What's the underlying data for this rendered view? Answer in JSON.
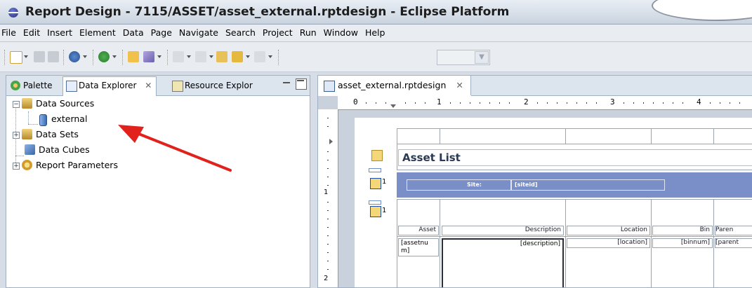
{
  "window": {
    "title": "Report Design - 7115/ASSET/asset_external.rptdesign - Eclipse Platform"
  },
  "menu": [
    "File",
    "Edit",
    "Insert",
    "Element",
    "Data",
    "Page",
    "Navigate",
    "Search",
    "Project",
    "Run",
    "Window",
    "Help"
  ],
  "left_panel": {
    "tabs": [
      {
        "label": "Palette"
      },
      {
        "label": "Data Explorer",
        "close": "✕"
      },
      {
        "label": "Resource Explor"
      }
    ],
    "tree": {
      "data_sources": "Data Sources",
      "external": "external",
      "data_sets": "Data Sets",
      "data_cubes": "Data Cubes",
      "report_parameters": "Report Parameters"
    }
  },
  "editor": {
    "tab_label": "asset_external.rptdesign",
    "tab_close": "✕",
    "ruler_numbers": [
      "0",
      "1",
      "2",
      "3",
      "4"
    ],
    "ruler_left_numbers": [
      "1",
      "2"
    ],
    "report": {
      "title": "Asset List",
      "group_site_label": "Site:",
      "group_site_value": "[siteid]",
      "row_markers": [
        "1",
        "1"
      ],
      "columns": [
        "Asset",
        "Description",
        "Location",
        "Bin",
        "Paren"
      ],
      "detail": [
        "[assetnum]",
        "[description]",
        "[location]",
        "[binnum]",
        "[parent"
      ]
    }
  },
  "colors": {
    "accent_arrow": "#e0211c",
    "group_band": "#7a8fc8"
  }
}
